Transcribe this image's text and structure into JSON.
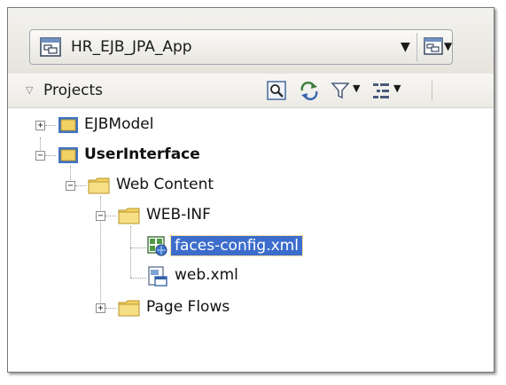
{
  "app_selector": {
    "value": "HR_EJB_JPA_App",
    "icon": "application-icon",
    "dropdown_icon": "chevron-down-icon"
  },
  "projects_panel": {
    "title": "Projects",
    "toolbar": [
      "search-icon",
      "refresh-icon",
      "filter-icon",
      "tree-options-icon"
    ]
  },
  "tree": {
    "nodes": [
      {
        "label": "EJBModel",
        "icon": "project-folder-icon",
        "expanded": false
      },
      {
        "label": "UserInterface",
        "icon": "project-folder-icon",
        "expanded": true
      },
      {
        "label": "Web Content",
        "icon": "folder-icon",
        "expanded": true
      },
      {
        "label": "WEB-INF",
        "icon": "folder-icon",
        "expanded": true
      },
      {
        "label": "faces-config.xml",
        "icon": "faces-config-icon",
        "selected": true
      },
      {
        "label": "web.xml",
        "icon": "web-xml-icon"
      },
      {
        "label": "Page Flows",
        "icon": "folder-icon",
        "expanded": false
      }
    ]
  },
  "colors": {
    "selection": "#3d6dcc",
    "selection_outline": "#f0c24b",
    "folder": "#f2d264"
  }
}
